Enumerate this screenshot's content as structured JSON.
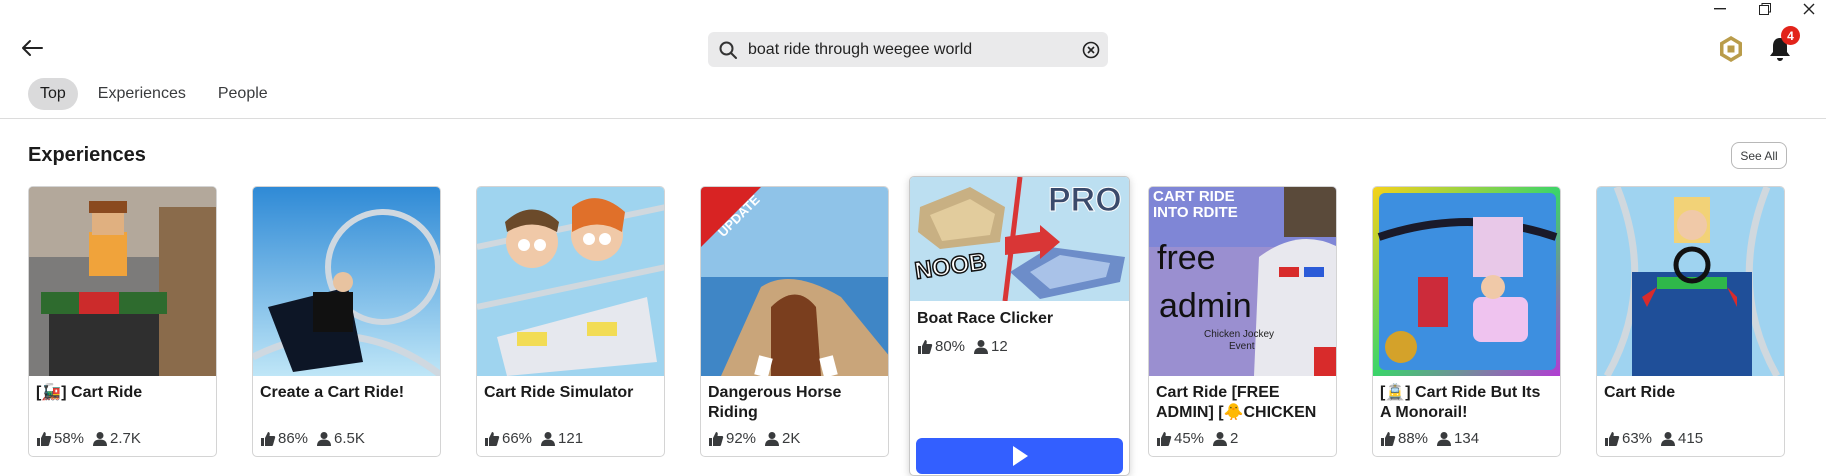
{
  "search": {
    "value": "boat ride through weegee world",
    "placeholder": "Search"
  },
  "notifications": {
    "count": "4"
  },
  "tabs": [
    {
      "label": "Top",
      "active": true
    },
    {
      "label": "Experiences",
      "active": false
    },
    {
      "label": "People",
      "active": false
    }
  ],
  "section": {
    "title": "Experiences",
    "see_all": "See All"
  },
  "cards": [
    {
      "name": "[🚂] Cart Ride",
      "rating": "58%",
      "players": "2.7K"
    },
    {
      "name": "Create a Cart Ride!",
      "rating": "86%",
      "players": "6.5K"
    },
    {
      "name": "Cart Ride Simulator",
      "rating": "66%",
      "players": "121"
    },
    {
      "name": "Dangerous Horse Riding",
      "rating": "92%",
      "players": "2K",
      "thumb_text": "UPDATE"
    },
    {
      "name": "Boat Race Clicker",
      "rating": "80%",
      "players": "12",
      "thumb_text_1": "NOOB",
      "thumb_text_2": "PRO"
    },
    {
      "name": "Cart Ride [FREE ADMIN]  [🐥CHICKEN",
      "rating": "45%",
      "players": "2",
      "thumb_text_1": "CART RIDE",
      "thumb_text_2": "INTO RDITE",
      "thumb_text_3": "free",
      "thumb_text_4": "admin",
      "thumb_text_5": "Chicken Jockey",
      "thumb_text_6": "Event"
    },
    {
      "name": "[🚊] Cart Ride But Its A Monorail!",
      "rating": "88%",
      "players": "134"
    },
    {
      "name": "Cart Ride",
      "rating": "63%",
      "players": "415"
    }
  ],
  "colors": {
    "accent": "#335fff",
    "badge": "#e2231a",
    "tab_active_bg": "#dadadb"
  }
}
